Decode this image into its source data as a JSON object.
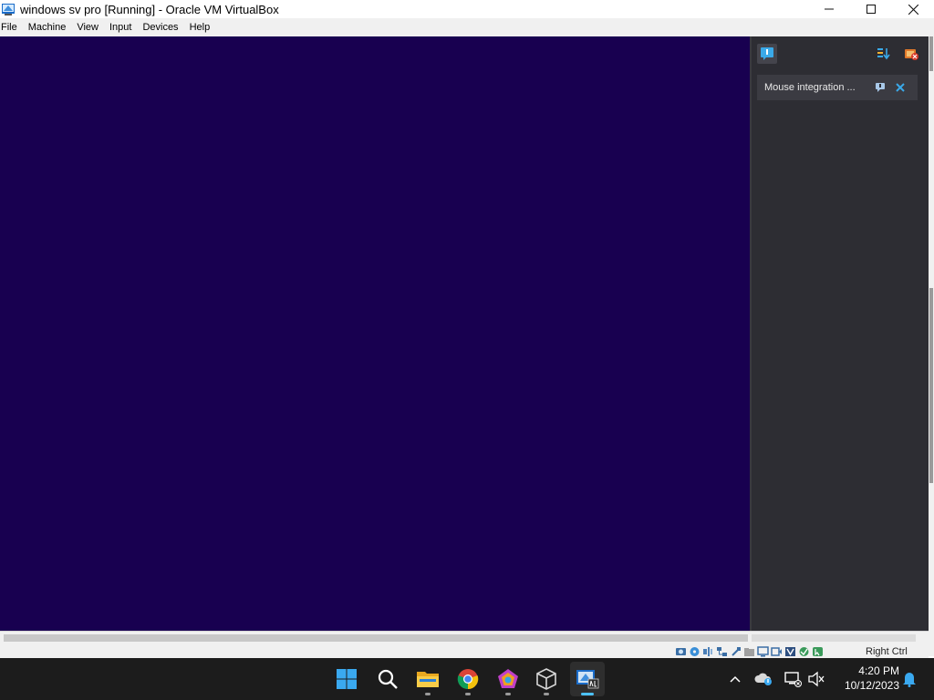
{
  "window": {
    "title": "windows  sv pro [Running] - Oracle VM VirtualBox",
    "controls": {
      "minimize": "minimize",
      "maximize": "maximize",
      "close": "close"
    }
  },
  "menubar": {
    "items": [
      "File",
      "Machine",
      "View",
      "Input",
      "Devices",
      "Help"
    ]
  },
  "colors": {
    "vm_background": "#180050",
    "panel_background": "#2d2d33",
    "card_background": "#3b3b42",
    "taskbar": "#1c1c1c",
    "accent": "#4cc2ff"
  },
  "notification_panel": {
    "toolbar_icons": [
      "notification-center-icon",
      "sort-icon",
      "dismiss-all-icon"
    ],
    "cards": [
      {
        "text": "Mouse integration ...",
        "icons": [
          "help-icon",
          "close-icon"
        ]
      }
    ]
  },
  "statusbar": {
    "host_key": "Right Ctrl",
    "icons": [
      "hard-disk-icon",
      "optical-drive-icon",
      "audio-icon",
      "network-icon",
      "usb-icon",
      "shared-folders-icon",
      "display-icon",
      "recording-icon",
      "vt-x-icon",
      "guest-additions-icon",
      "mouse-integration-icon"
    ]
  },
  "taskbar": {
    "apps": [
      "start-icon",
      "search-icon",
      "file-explorer-icon",
      "chrome-icon",
      "copilot-icon",
      "virtualbox-manager-icon",
      "virtualbox-vm-icon"
    ],
    "tray": [
      "show-hidden-icons-chevron",
      "onedrive-icon",
      "network-icon",
      "volume-muted-icon"
    ],
    "time": "4:20 PM",
    "date": "10/12/2023",
    "notification_bell": "notification-bell-icon"
  }
}
